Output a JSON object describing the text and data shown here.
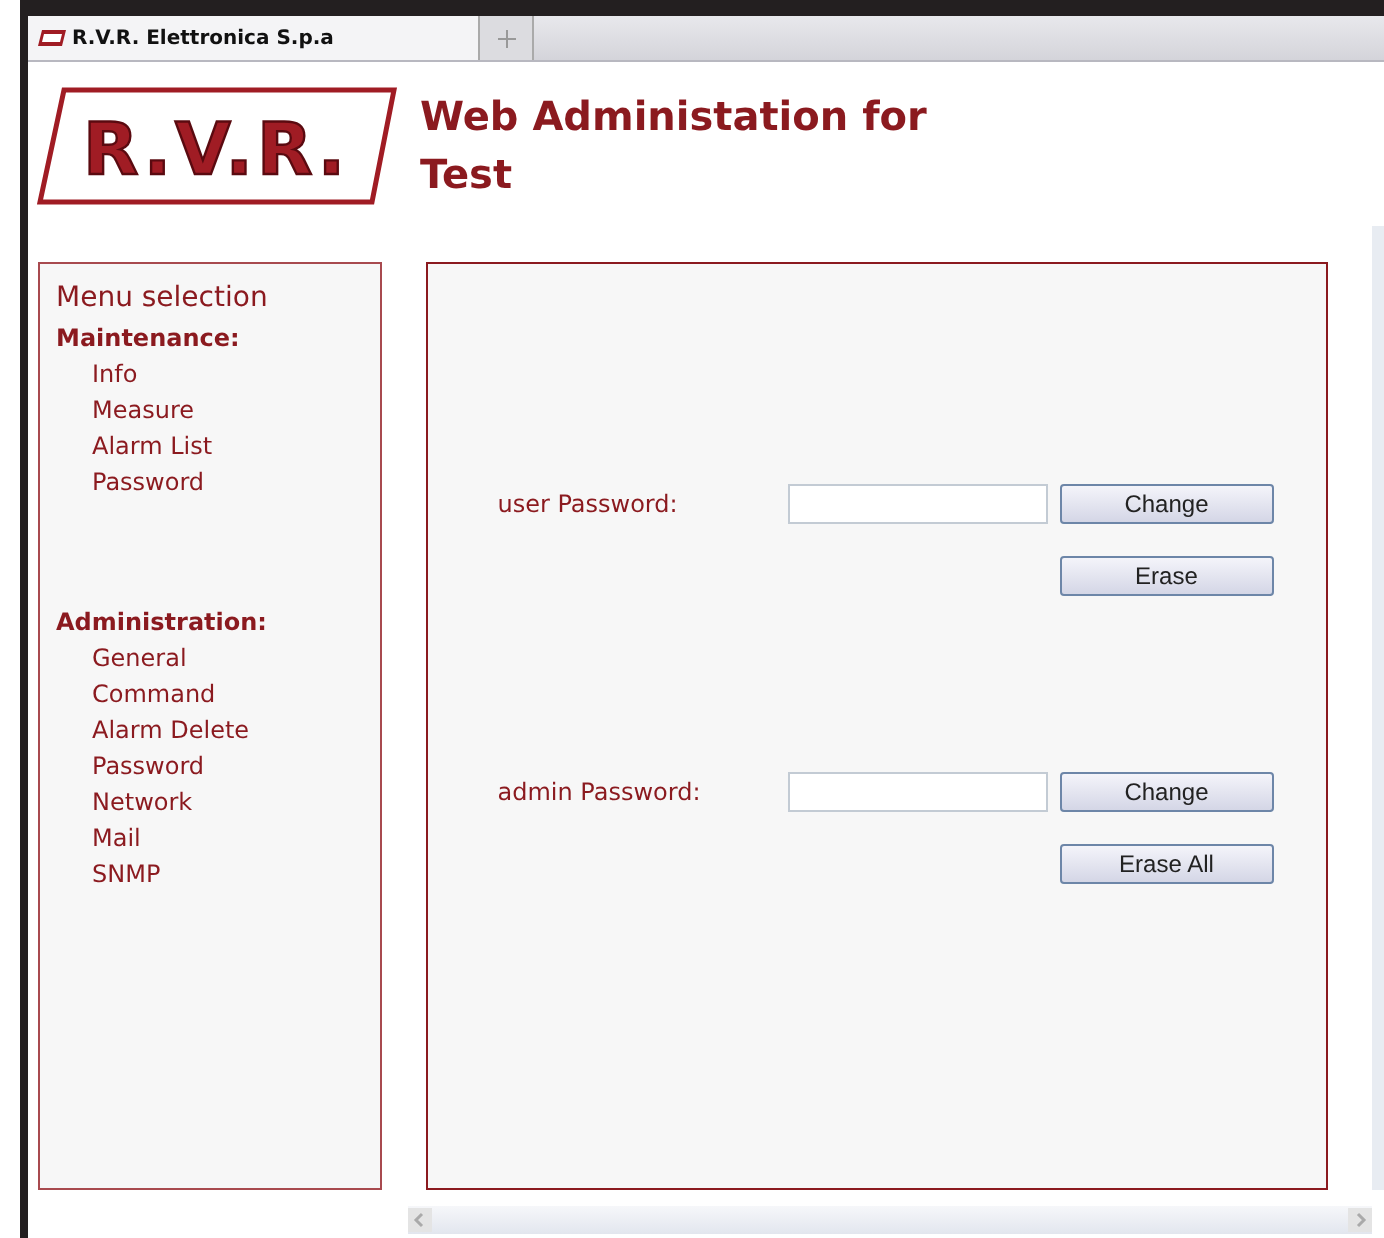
{
  "browser_tab": {
    "title": "R.V.R. Elettronica S.p.a"
  },
  "logo": {
    "text": "R.V.R."
  },
  "page_title": [
    "Web Administation for",
    "Test"
  ],
  "sidebar": {
    "title": "Menu selection",
    "groups": [
      {
        "heading": "Maintenance:",
        "items": [
          "Info",
          "Measure",
          "Alarm List",
          "Password"
        ]
      },
      {
        "heading": "Administration:",
        "items": [
          "General",
          "Command",
          "Alarm Delete",
          "Password",
          "Network",
          "Mail",
          "SNMP"
        ]
      }
    ]
  },
  "password_rows": [
    {
      "label": "user Password:",
      "buttons": [
        "Change",
        "Erase"
      ]
    },
    {
      "label": "admin Password:",
      "buttons": [
        "Change",
        "Erase All"
      ]
    }
  ]
}
